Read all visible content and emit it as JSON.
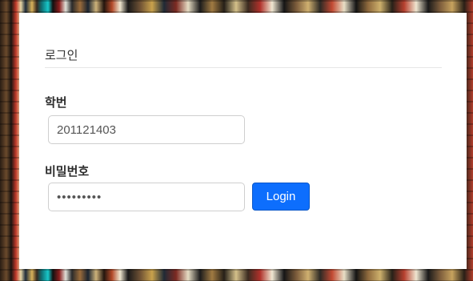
{
  "login_card": {
    "title": "로그인",
    "student_id": {
      "label": "학번",
      "value": "201121403"
    },
    "password": {
      "label": "비밀번호",
      "value": "201121403"
    },
    "login_button_label": "Login"
  },
  "colors": {
    "button_primary": "#0d6efd",
    "card_background": "#ffffff"
  }
}
